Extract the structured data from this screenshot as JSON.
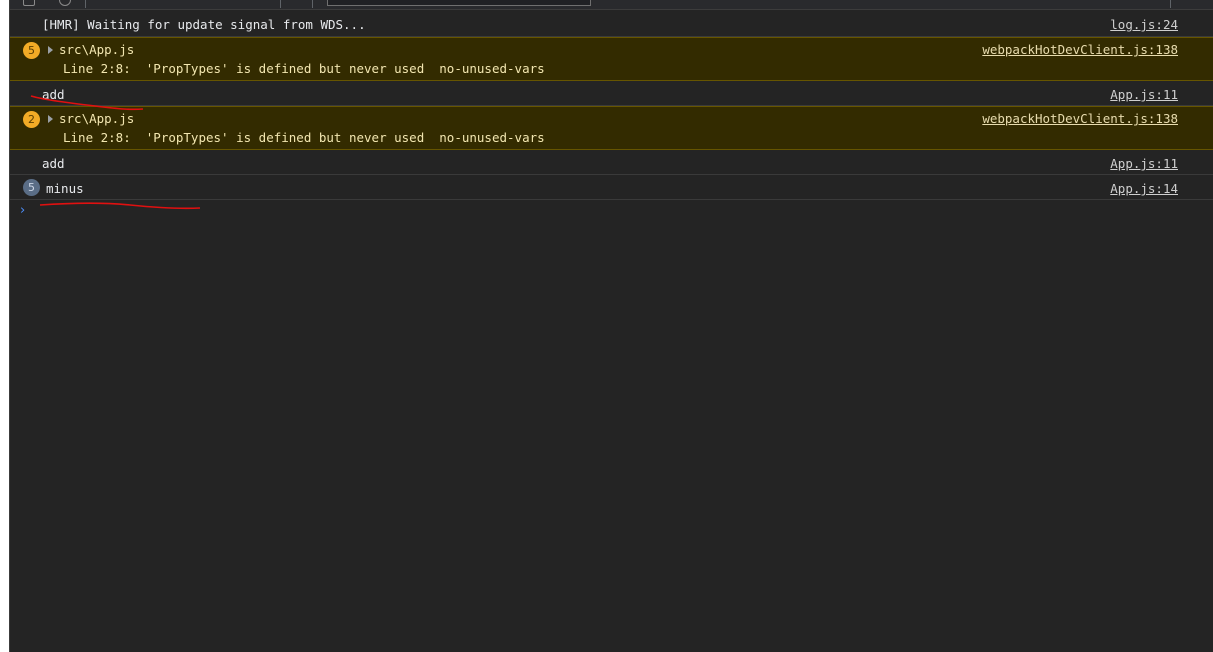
{
  "console": {
    "messages": [
      {
        "text": "[HMR] Waiting for update signal from WDS...",
        "source": "log.js:24"
      },
      {
        "badge": "5",
        "title": "src\\App.js",
        "detail": "Line 2:8:  'PropTypes' is defined but never used  no-unused-vars",
        "source": "webpackHotDevClient.js:138"
      },
      {
        "text": "add",
        "source": "App.js:11"
      },
      {
        "badge": "2",
        "title": "src\\App.js",
        "detail": "Line 2:8:  'PropTypes' is defined but never used  no-unused-vars",
        "source": "webpackHotDevClient.js:138"
      },
      {
        "text": "add",
        "source": "App.js:11"
      },
      {
        "badge": "5",
        "text": "minus",
        "source": "App.js:14"
      }
    ],
    "prompt_symbol": "›"
  },
  "colors": {
    "warning_background": "#332b00",
    "warning_badge": "#f2ab26",
    "info_badge": "#5a6d86",
    "annotation_underline": "#e01010"
  },
  "icons": [
    "expand-triangle-icon",
    "prompt-caret-icon"
  ]
}
